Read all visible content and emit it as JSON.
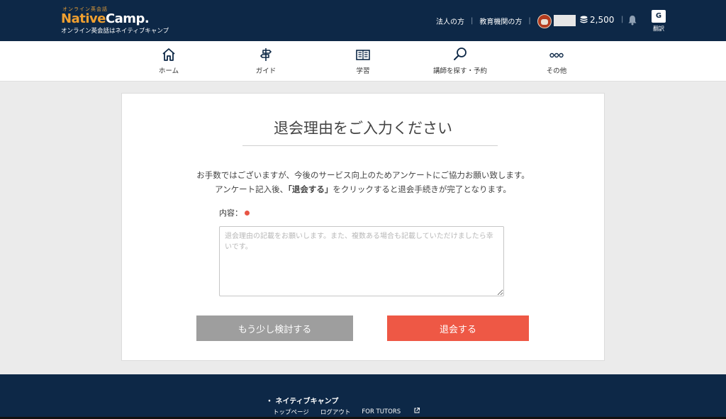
{
  "header": {
    "logo_tagline": "オンライン英会話",
    "logo_part1": "Native",
    "logo_part2": "Camp.",
    "logo_sub": "オンライン英会話はネイティブキャンプ",
    "links": [
      "法人の方",
      "教育機関の方"
    ],
    "points": "2,500",
    "translate_icon": "G",
    "translate_label": "翻訳"
  },
  "nav": {
    "items": [
      {
        "label": "ホーム",
        "icon": "home-icon"
      },
      {
        "label": "ガイド",
        "icon": "signpost-icon"
      },
      {
        "label": "学習",
        "icon": "book-icon"
      },
      {
        "label": "講師を探す・予約",
        "icon": "search-icon"
      },
      {
        "label": "その他",
        "icon": "more-icon"
      }
    ]
  },
  "main": {
    "title": "退会理由をご入力ください",
    "desc_line1": "お手数ではございますが、今後のサービス向上のためアンケートにご協力お願い致します。",
    "desc_line2_pre": "アンケート記入後、",
    "desc_line2_bold": "「退会する」",
    "desc_line2_post": "をクリックすると退会手続きが完了となります。",
    "field_label": "内容：",
    "placeholder": "退会理由の記載をお願いします。また、複数ある場合も記載していただけましたら幸いです。",
    "back_button": "もう少し検討する",
    "quit_button": "退会する",
    "colors": {
      "quit": "#ee5845",
      "back": "#9e9e9e",
      "required": "#e85545"
    }
  },
  "footer": {
    "title": "・ ネイティブキャンプ",
    "links": [
      "トップページ",
      "ログアウト",
      "FOR TUTORS"
    ]
  },
  "colors": {
    "header_bg": "#0d2847",
    "logo_accent": "#f0a030"
  }
}
